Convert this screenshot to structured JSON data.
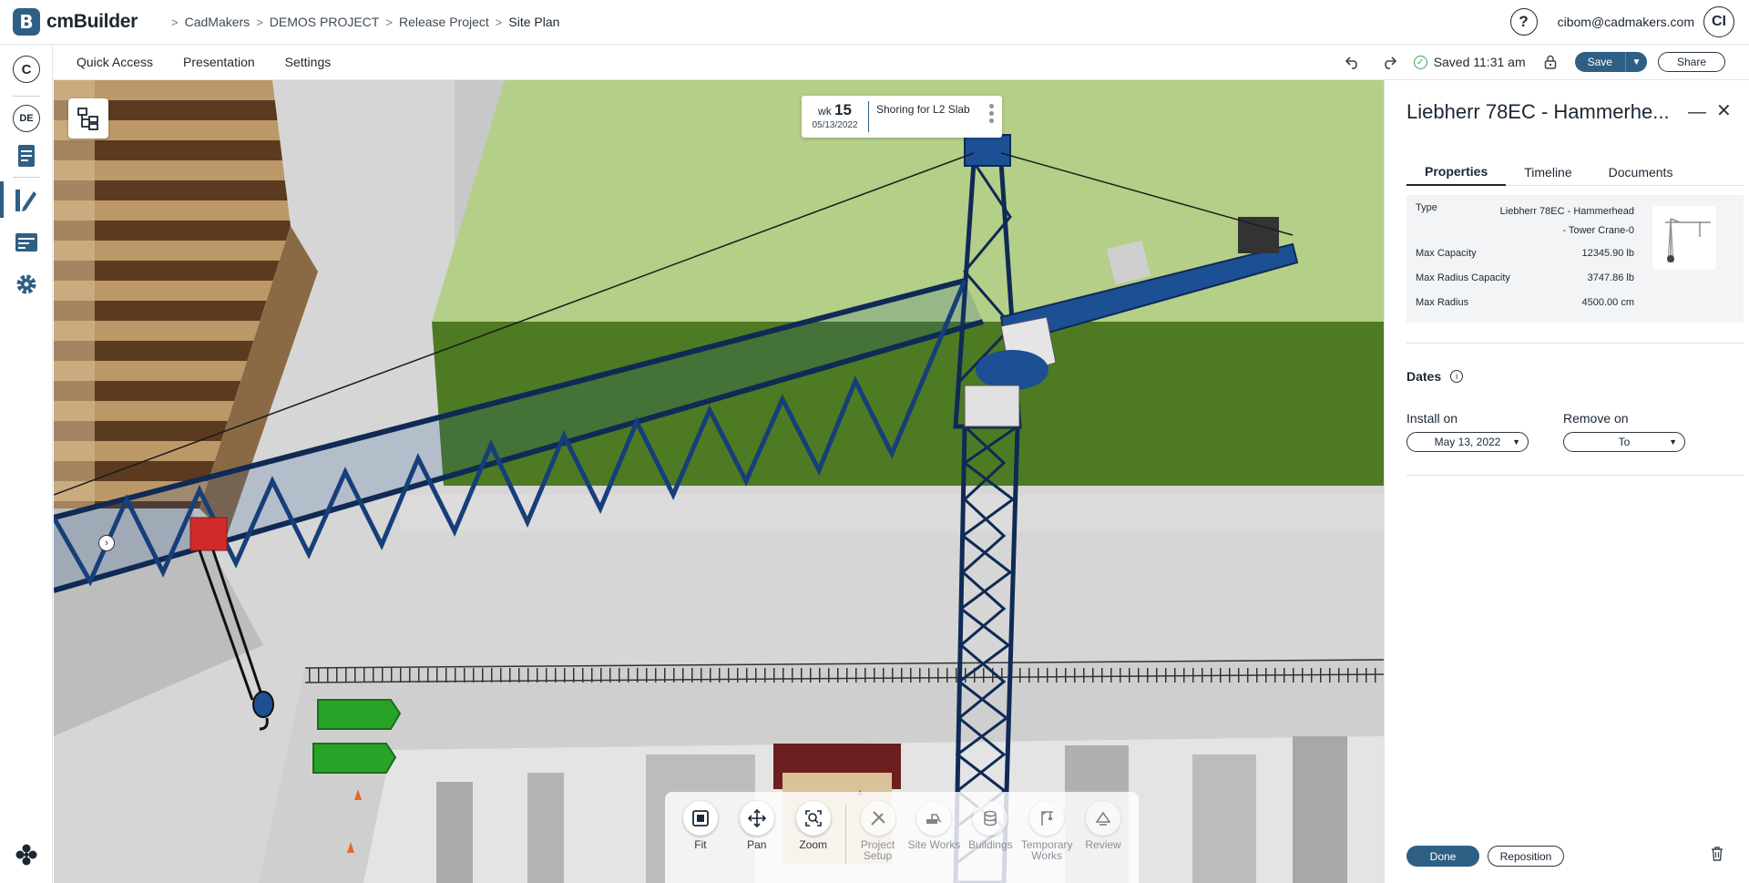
{
  "app": {
    "logo_letter": "B",
    "name": "cmBuilder"
  },
  "breadcrumb": [
    "CadMakers",
    "DEMOS PROJECT",
    "Release Project",
    "Site Plan"
  ],
  "header": {
    "help": "?",
    "user_email": "cibom@cadmakers.com",
    "avatar_initials": "CI"
  },
  "left_rail": {
    "company_initial": "C",
    "project_initial": "DE"
  },
  "menu": [
    "Quick Access",
    "Presentation",
    "Settings"
  ],
  "save_status": "Saved 11:31 am",
  "buttons": {
    "save": "Save",
    "share": "Share",
    "done": "Done",
    "reposition": "Reposition"
  },
  "schedule": {
    "wk_prefix": "wk",
    "week_number": "15",
    "date": "05/13/2022",
    "task": "Shoring for L2 Slab"
  },
  "tools": {
    "view": [
      {
        "name": "fit",
        "label": "Fit"
      },
      {
        "name": "pan",
        "label": "Pan"
      },
      {
        "name": "zoom",
        "label": "Zoom"
      }
    ],
    "modes": [
      {
        "name": "project-setup",
        "label": "Project Setup"
      },
      {
        "name": "site-works",
        "label": "Site Works"
      },
      {
        "name": "buildings",
        "label": "Buildings"
      },
      {
        "name": "temporary-works",
        "label": "Temporary Works"
      },
      {
        "name": "review",
        "label": "Review"
      }
    ]
  },
  "panel": {
    "title": "Liebherr 78EC - Hammerhe...",
    "tabs": [
      "Properties",
      "Timeline",
      "Documents"
    ],
    "properties": {
      "type_label": "Type",
      "type_line1": "Liebherr 78EC - Hammerhead",
      "type_line2": "- Tower Crane-0",
      "max_capacity_label": "Max Capacity",
      "max_capacity": "12345.90 lb",
      "max_radius_capacity_label": "Max Radius Capacity",
      "max_radius_capacity": "3747.86 lb",
      "max_radius_label": "Max Radius",
      "max_radius": "4500.00 cm"
    },
    "dates": {
      "heading": "Dates",
      "install_label": "Install on",
      "install_value": "May 13, 2022",
      "remove_label": "Remove on",
      "remove_value": "To"
    }
  },
  "colors": {
    "brand": "#2e5f84",
    "crane": "#1c4f94",
    "building_top": "#b4cf87",
    "building_side": "#4e7a23",
    "stripe_light": "#bc9868",
    "stripe_dark": "#5b3a1f",
    "dumpster": "#27a427"
  }
}
